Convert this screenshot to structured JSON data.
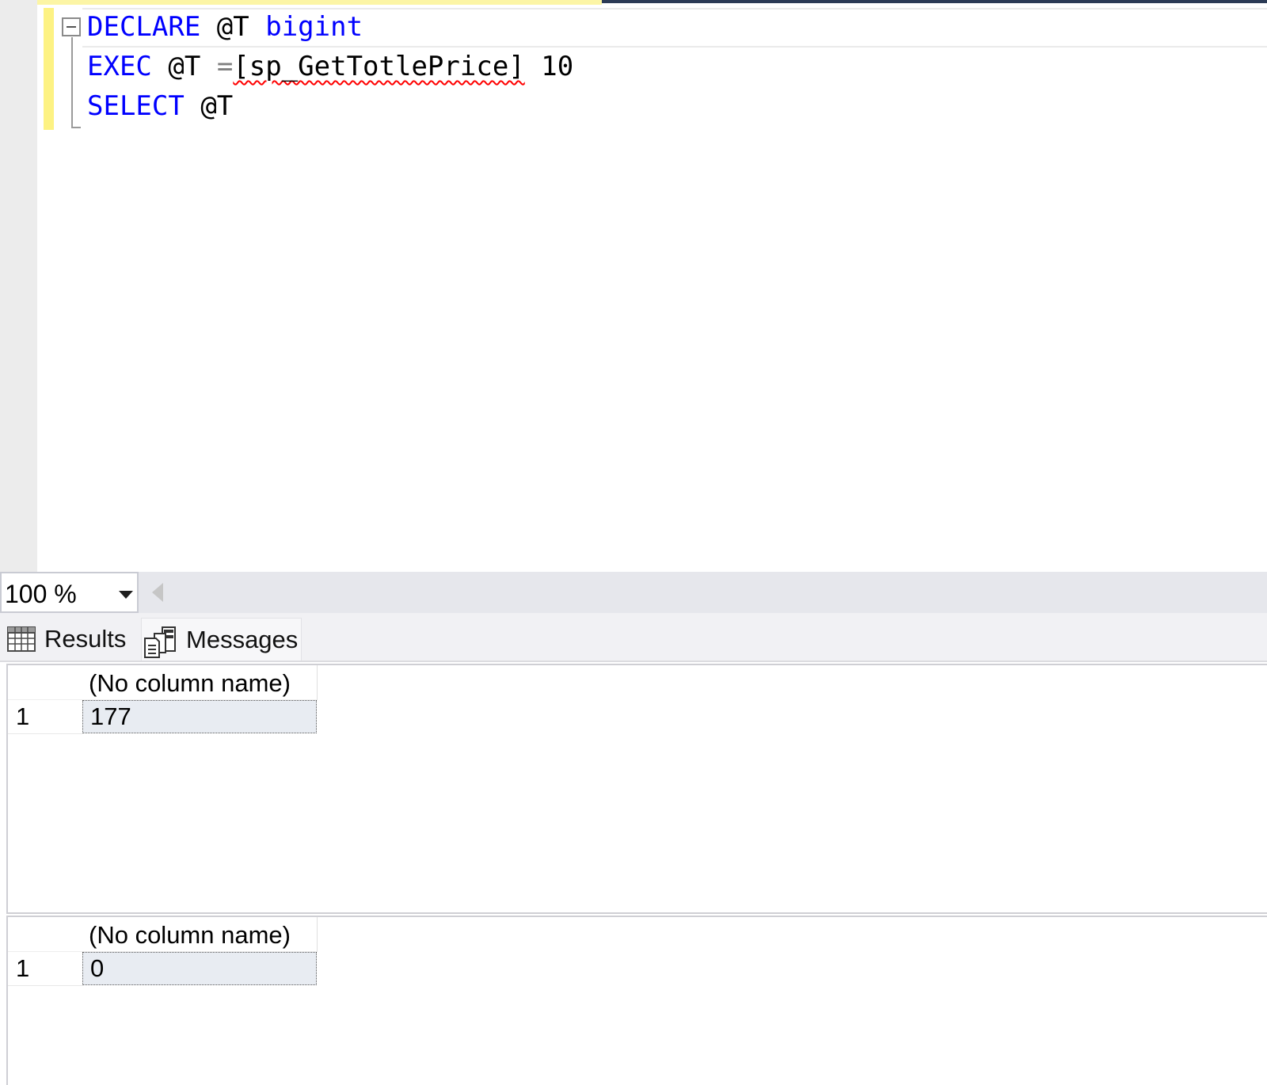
{
  "editor": {
    "lines": [
      {
        "keyword": "DECLARE",
        "variable": "@T",
        "type": "bigint"
      },
      {
        "keyword": "EXEC",
        "variable": "@T",
        "operator": "=",
        "procedure": "[sp_GetTotlePrice]",
        "argument": "10"
      },
      {
        "keyword": "SELECT",
        "variable": "@T"
      }
    ]
  },
  "zoom": {
    "value": "100 %"
  },
  "tabs": [
    {
      "label": "Results",
      "icon": "grid-icon"
    },
    {
      "label": "Messages",
      "icon": "messages-icon"
    }
  ],
  "results": [
    {
      "column": "(No column name)",
      "row_number": "1",
      "value": "177"
    },
    {
      "column": "(No column name)",
      "row_number": "1",
      "value": "0"
    }
  ],
  "colors": {
    "keyword": "#0000ff",
    "operator": "#808080",
    "error_squiggle": "#ff0000",
    "change_bar": "#fdf283"
  }
}
